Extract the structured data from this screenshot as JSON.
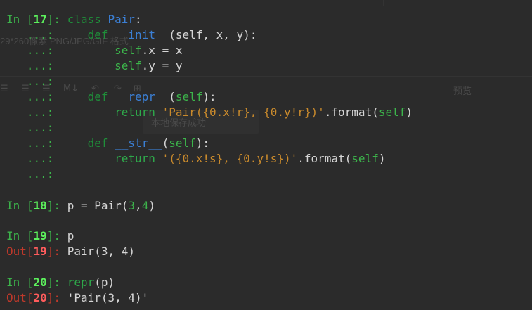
{
  "ghost": {
    "file_text": "29*260像素 PNG/JPG/GIF 格式",
    "save_toast": "本地保存成功",
    "preview_label": "预览",
    "toolbar_glyphs": [
      "☰",
      "☰",
      "☰",
      "M↓",
      "↶",
      "↷",
      "⊞"
    ]
  },
  "prompts": {
    "in_label": "In [",
    "out_label": "Out[",
    "close": "]:",
    "continuation": "...:"
  },
  "cells": [
    {
      "number": "17"
    },
    {
      "number": "18"
    },
    {
      "number": "19"
    },
    {
      "number": "20"
    }
  ],
  "code": {
    "c17_l1_kw": "class",
    "c17_l1_name": "Pair",
    "c17_l1_colon": ":",
    "c17_l2_def": "def",
    "c17_l2_fn": "__init__",
    "c17_l2_rest": "(self, x, y):",
    "c17_l3_self": "self",
    "c17_l3_rest": ".x = x",
    "c17_l4_self": "self",
    "c17_l4_rest": ".y = y",
    "c17_l6_def": "def",
    "c17_l6_fn": "__repr__",
    "c17_l6_paren": "(",
    "c17_l6_self": "self",
    "c17_l6_end": "):",
    "c17_l7_ret": "return",
    "c17_l7_str": "'Pair({0.x!r}, {0.y!r})'",
    "c17_l7_mid": ".format(",
    "c17_l7_self": "self",
    "c17_l7_end": ")",
    "c17_l9_def": "def",
    "c17_l9_fn": "__str__",
    "c17_l9_paren": "(",
    "c17_l9_self": "self",
    "c17_l9_end": "):",
    "c17_l10_ret": "return",
    "c17_l10_str": "'({0.x!s}, {0.y!s})'",
    "c17_l10_mid": ".format(",
    "c17_l10_self": "self",
    "c17_l10_end": ")",
    "c18_a": "p = Pair(",
    "c18_n1": "3",
    "c18_comma": ",",
    "c18_n2": "4",
    "c18_end": ")",
    "c19_in": "p",
    "c19_out": "Pair(3, 4)",
    "c20_fn": "repr",
    "c20_rest": "(p)",
    "c20_out": "'Pair(3, 4)'"
  },
  "colors": {
    "background": "#2b2b2b",
    "prompt_in": "#3cb44b",
    "prompt_out": "#c0392b",
    "keyword": "#1f8f3a",
    "function": "#3b7fd4",
    "string": "#c98a2c",
    "text": "#d6d6d6"
  }
}
